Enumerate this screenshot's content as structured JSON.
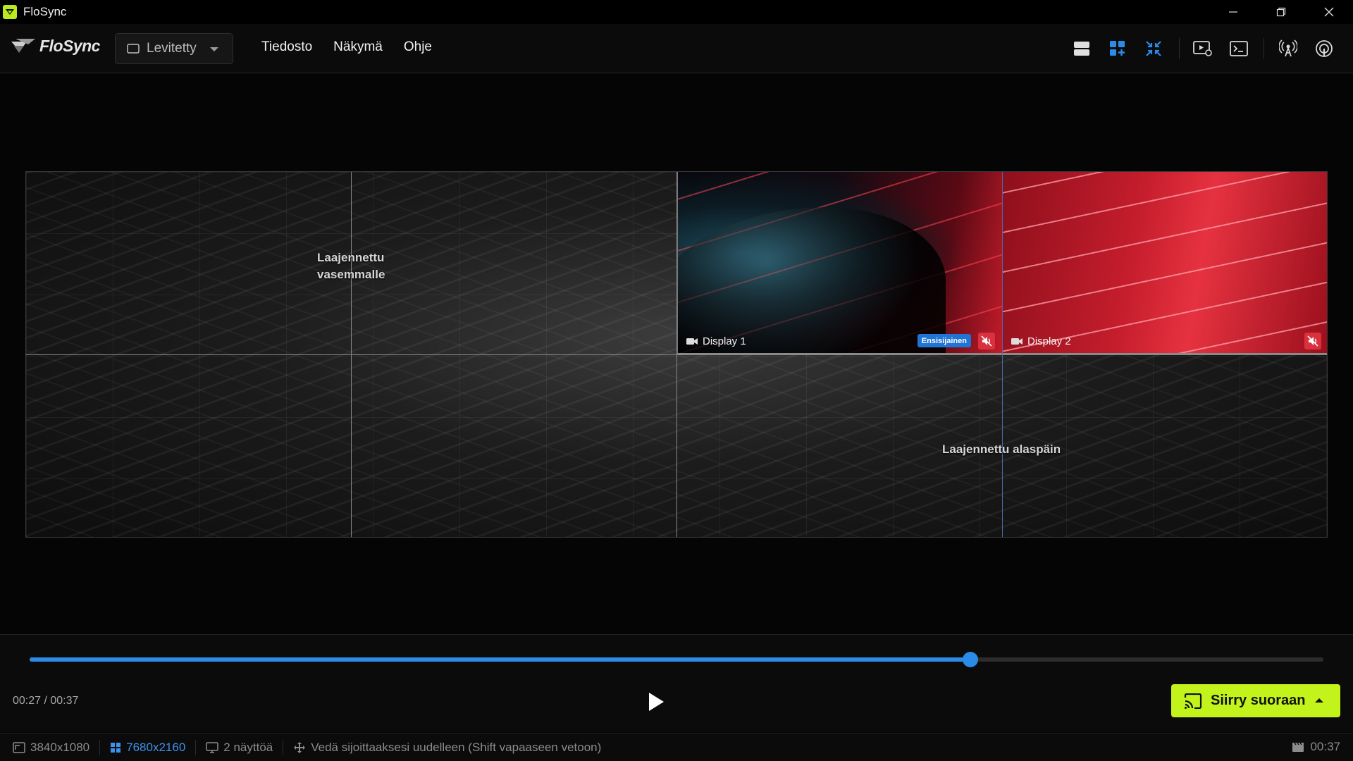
{
  "window": {
    "title": "FloSync",
    "brand_color": "#b8ea1e"
  },
  "menubar": {
    "brand": "FloSync",
    "layout_select": {
      "value": "Levitetty"
    },
    "menu": [
      "Tiedosto",
      "Näkymä",
      "Ohje"
    ],
    "toolbar_icons": [
      "layout-rows-icon",
      "layout-grid-add-icon",
      "collapse-icon",
      "preview-settings-icon",
      "terminal-icon",
      "broadcast-icon",
      "remote-icon"
    ],
    "accent_color": "#2b8be8"
  },
  "canvas": {
    "overlay_left": "Laajennettu vasemmalle",
    "overlay_bottom": "Laajennettu alaspäin",
    "displays": [
      {
        "label": "Display 1",
        "badge": "Ensisijainen",
        "muted": true
      },
      {
        "label": "Display 2",
        "muted": true
      }
    ]
  },
  "playback": {
    "time": "00:27 / 00:37",
    "progress": 0.727,
    "go_live_label": "Siirry suoraan",
    "go_live_color": "#c2f31a"
  },
  "statusbar": {
    "display_resolution": "3840x1080",
    "canvas_resolution": "7680x2160",
    "display_count": "2 näyttöä",
    "hint": "Vedä sijoittaaksesi uudelleen (Shift vapaaseen vetoon)",
    "duration": "00:37"
  }
}
